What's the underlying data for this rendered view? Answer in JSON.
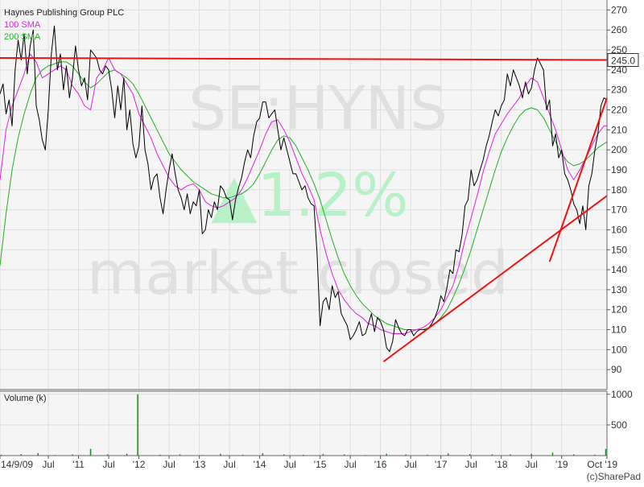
{
  "chart_data": {
    "type": "line",
    "title": "Haynes Publishing Group PLC",
    "watermark": {
      "ticker": "SE:HYNS",
      "change": "▲1.2%",
      "status": "market closed"
    },
    "last_price_label": "245.0",
    "credit": "(c)SharePad",
    "colors": {
      "price": "#000000",
      "sma100": "#e020e0",
      "sma200": "#20b020",
      "trend": "#ee1111",
      "volume": "#1a8a1a",
      "grid": "#dddddd",
      "bg": "#f5f5f5",
      "watermark": "#e0e0e0",
      "watermark_change": "#b8f0c8"
    },
    "legend": [
      "100 SMA",
      "200 SMA"
    ],
    "x_ticks": [
      "14/9/09",
      "Jul",
      "'11",
      "Jul",
      "'12",
      "Jul",
      "'13",
      "Jul",
      "'14",
      "Jul",
      "'15",
      "Jul",
      "'16",
      "Jul",
      "'17",
      "Jul",
      "'18",
      "Jul",
      "'19",
      "Oct '19"
    ],
    "x_tick_values": [
      2009.7,
      2010.5,
      2011.0,
      2011.5,
      2012.0,
      2012.5,
      2013.0,
      2013.5,
      2014.0,
      2014.5,
      2015.0,
      2015.5,
      2016.0,
      2016.5,
      2017.0,
      2017.5,
      2018.0,
      2018.5,
      2019.0,
      2019.75
    ],
    "xlim": [
      2009.7,
      2019.75
    ],
    "ylim": [
      80,
      275
    ],
    "y_ticks": [
      90,
      100,
      110,
      120,
      130,
      140,
      150,
      160,
      170,
      180,
      190,
      200,
      210,
      220,
      230,
      240,
      250,
      260,
      270
    ],
    "price": {
      "x": [
        2009.7,
        2009.75,
        2009.8,
        2009.85,
        2009.9,
        2009.95,
        2010.0,
        2010.05,
        2010.1,
        2010.15,
        2010.2,
        2010.25,
        2010.3,
        2010.35,
        2010.4,
        2010.45,
        2010.5,
        2010.55,
        2010.6,
        2010.65,
        2010.7,
        2010.75,
        2010.8,
        2010.85,
        2010.9,
        2010.95,
        2011.0,
        2011.05,
        2011.1,
        2011.15,
        2011.2,
        2011.25,
        2011.3,
        2011.35,
        2011.4,
        2011.45,
        2011.5,
        2011.55,
        2011.6,
        2011.65,
        2011.7,
        2011.75,
        2011.8,
        2011.85,
        2011.9,
        2011.95,
        2012.0,
        2012.05,
        2012.1,
        2012.15,
        2012.2,
        2012.25,
        2012.3,
        2012.35,
        2012.4,
        2012.45,
        2012.5,
        2012.55,
        2012.6,
        2012.65,
        2012.7,
        2012.75,
        2012.8,
        2012.85,
        2012.9,
        2012.95,
        2013.0,
        2013.05,
        2013.1,
        2013.15,
        2013.2,
        2013.25,
        2013.3,
        2013.35,
        2013.4,
        2013.45,
        2013.5,
        2013.55,
        2013.6,
        2013.65,
        2013.7,
        2013.75,
        2013.8,
        2013.85,
        2013.9,
        2013.95,
        2014.0,
        2014.05,
        2014.1,
        2014.15,
        2014.2,
        2014.25,
        2014.3,
        2014.35,
        2014.4,
        2014.45,
        2014.5,
        2014.55,
        2014.6,
        2014.65,
        2014.7,
        2014.75,
        2014.8,
        2014.85,
        2014.9,
        2014.95,
        2015.0,
        2015.05,
        2015.1,
        2015.15,
        2015.2,
        2015.25,
        2015.3,
        2015.35,
        2015.4,
        2015.45,
        2015.5,
        2015.55,
        2015.6,
        2015.65,
        2015.7,
        2015.75,
        2015.8,
        2015.85,
        2015.9,
        2015.95,
        2016.0,
        2016.05,
        2016.1,
        2016.15,
        2016.2,
        2016.25,
        2016.3,
        2016.35,
        2016.4,
        2016.45,
        2016.5,
        2016.55,
        2016.6,
        2016.65,
        2016.7,
        2016.75,
        2016.8,
        2016.85,
        2016.9,
        2016.95,
        2017.0,
        2017.05,
        2017.1,
        2017.15,
        2017.2,
        2017.25,
        2017.3,
        2017.35,
        2017.4,
        2017.45,
        2017.5,
        2017.55,
        2017.6,
        2017.65,
        2017.7,
        2017.75,
        2017.8,
        2017.85,
        2017.9,
        2017.95,
        2018.0,
        2018.05,
        2018.1,
        2018.15,
        2018.2,
        2018.25,
        2018.3,
        2018.35,
        2018.4,
        2018.45,
        2018.5,
        2018.55,
        2018.6,
        2018.65,
        2018.7,
        2018.75,
        2018.8,
        2018.85,
        2018.9,
        2018.95,
        2019.0,
        2019.05,
        2019.1,
        2019.15,
        2019.2,
        2019.25,
        2019.3,
        2019.35,
        2019.4,
        2019.45,
        2019.5,
        2019.55,
        2019.6,
        2019.65,
        2019.7,
        2019.75
      ],
      "y": [
        228,
        233,
        218,
        225,
        212,
        240,
        255,
        245,
        258,
        238,
        252,
        260,
        222,
        215,
        205,
        200,
        220,
        248,
        262,
        240,
        248,
        230,
        242,
        226,
        236,
        252,
        240,
        232,
        236,
        225,
        250,
        248,
        246,
        240,
        238,
        242,
        240,
        230,
        216,
        232,
        220,
        236,
        210,
        220,
        203,
        196,
        202,
        222,
        200,
        193,
        180,
        186,
        188,
        176,
        168,
        180,
        190,
        198,
        188,
        180,
        176,
        170,
        178,
        168,
        174,
        172,
        180,
        158,
        160,
        170,
        166,
        174,
        170,
        182,
        180,
        176,
        175,
        165,
        175,
        181,
        186,
        194,
        200,
        196,
        207,
        214,
        216,
        224,
        224,
        216,
        218,
        220,
        210,
        200,
        206,
        200,
        194,
        188,
        188,
        184,
        180,
        182,
        176,
        173,
        172,
        148,
        112,
        124,
        126,
        120,
        132,
        126,
        129,
        118,
        115,
        112,
        105,
        107,
        110,
        114,
        107,
        108,
        113,
        118,
        109,
        116,
        114,
        110,
        101,
        99,
        104,
        115,
        111,
        108,
        107,
        110,
        110,
        107,
        109,
        110,
        110,
        110,
        111,
        113,
        116,
        120,
        127,
        124,
        131,
        140,
        138,
        150,
        149,
        157,
        172,
        175,
        190,
        182,
        185,
        190,
        195,
        202,
        207,
        214,
        220,
        217,
        222,
        225,
        238,
        232,
        240,
        236,
        232,
        226,
        234,
        228,
        231,
        240,
        246,
        243,
        240,
        220,
        225,
        202,
        208,
        196,
        200,
        188,
        185,
        180,
        173,
        170,
        163,
        172,
        160,
        182,
        188,
        200,
        208,
        222,
        226,
        225,
        222,
        220,
        221,
        245
      ]
    },
    "sma100": {
      "x": [
        2009.7,
        2009.8,
        2009.9,
        2010.0,
        2010.1,
        2010.2,
        2010.3,
        2010.4,
        2010.5,
        2010.6,
        2010.7,
        2010.8,
        2010.9,
        2011.0,
        2011.1,
        2011.2,
        2011.3,
        2011.4,
        2011.5,
        2011.6,
        2011.7,
        2011.8,
        2011.9,
        2012.0,
        2012.1,
        2012.2,
        2012.3,
        2012.4,
        2012.5,
        2012.6,
        2012.7,
        2012.8,
        2012.9,
        2013.0,
        2013.1,
        2013.2,
        2013.3,
        2013.4,
        2013.5,
        2013.6,
        2013.7,
        2013.8,
        2013.9,
        2014.0,
        2014.1,
        2014.2,
        2014.3,
        2014.4,
        2014.5,
        2014.6,
        2014.7,
        2014.8,
        2014.9,
        2015.0,
        2015.1,
        2015.2,
        2015.3,
        2015.4,
        2015.5,
        2015.6,
        2015.7,
        2015.8,
        2015.9,
        2016.0,
        2016.1,
        2016.2,
        2016.3,
        2016.4,
        2016.5,
        2016.6,
        2016.7,
        2016.8,
        2016.9,
        2017.0,
        2017.1,
        2017.2,
        2017.3,
        2017.4,
        2017.5,
        2017.6,
        2017.7,
        2017.8,
        2017.9,
        2018.0,
        2018.1,
        2018.2,
        2018.3,
        2018.4,
        2018.5,
        2018.6,
        2018.7,
        2018.8,
        2018.9,
        2019.0,
        2019.1,
        2019.2,
        2019.3,
        2019.4,
        2019.5,
        2019.6,
        2019.7,
        2019.75
      ],
      "y": [
        185,
        210,
        222,
        230,
        238,
        248,
        244,
        236,
        238,
        240,
        242,
        240,
        232,
        228,
        222,
        220,
        236,
        240,
        246,
        240,
        238,
        233,
        228,
        218,
        212,
        206,
        198,
        192,
        186,
        182,
        180,
        182,
        183,
        180,
        174,
        172,
        171,
        172,
        174,
        176,
        180,
        186,
        193,
        200,
        208,
        214,
        215,
        210,
        204,
        196,
        188,
        182,
        175,
        160,
        148,
        138,
        130,
        125,
        121,
        118,
        116,
        113,
        112,
        110,
        109,
        108,
        108,
        108,
        109,
        110,
        111,
        113,
        116,
        120,
        126,
        132,
        142,
        155,
        166,
        177,
        189,
        199,
        208,
        213,
        218,
        222,
        226,
        232,
        236,
        234,
        226,
        218,
        210,
        200,
        190,
        185,
        190,
        196,
        202,
        208,
        212,
        212
      ]
    },
    "sma200": {
      "x": [
        2009.7,
        2009.8,
        2009.9,
        2010.0,
        2010.1,
        2010.2,
        2010.3,
        2010.4,
        2010.5,
        2010.6,
        2010.7,
        2010.8,
        2010.9,
        2011.0,
        2011.1,
        2011.2,
        2011.3,
        2011.4,
        2011.5,
        2011.6,
        2011.7,
        2011.8,
        2011.9,
        2012.0,
        2012.1,
        2012.2,
        2012.3,
        2012.4,
        2012.5,
        2012.6,
        2012.7,
        2012.8,
        2012.9,
        2013.0,
        2013.1,
        2013.2,
        2013.3,
        2013.4,
        2013.5,
        2013.6,
        2013.7,
        2013.8,
        2013.9,
        2014.0,
        2014.1,
        2014.2,
        2014.3,
        2014.4,
        2014.5,
        2014.6,
        2014.7,
        2014.8,
        2014.9,
        2015.0,
        2015.1,
        2015.2,
        2015.3,
        2015.4,
        2015.5,
        2015.6,
        2015.7,
        2015.8,
        2015.9,
        2016.0,
        2016.1,
        2016.2,
        2016.3,
        2016.4,
        2016.5,
        2016.6,
        2016.7,
        2016.8,
        2016.9,
        2017.0,
        2017.1,
        2017.2,
        2017.3,
        2017.4,
        2017.5,
        2017.6,
        2017.7,
        2017.8,
        2017.9,
        2018.0,
        2018.1,
        2018.2,
        2018.3,
        2018.4,
        2018.5,
        2018.6,
        2018.7,
        2018.8,
        2018.9,
        2019.0,
        2019.1,
        2019.2,
        2019.3,
        2019.4,
        2019.5,
        2019.6,
        2019.7,
        2019.75
      ],
      "y": [
        142,
        168,
        190,
        206,
        218,
        228,
        236,
        240,
        242,
        243,
        244,
        244,
        242,
        238,
        234,
        231,
        233,
        236,
        239,
        240,
        238,
        236,
        233,
        228,
        222,
        216,
        210,
        204,
        198,
        194,
        190,
        187,
        184,
        182,
        180,
        178,
        177,
        176,
        176,
        177,
        178,
        180,
        183,
        188,
        194,
        200,
        205,
        207,
        206,
        202,
        196,
        190,
        183,
        175,
        165,
        155,
        146,
        138,
        132,
        127,
        123,
        120,
        117,
        115,
        113,
        112,
        111,
        110,
        110,
        110,
        110,
        111,
        113,
        116,
        120,
        126,
        133,
        141,
        150,
        160,
        170,
        180,
        190,
        199,
        206,
        212,
        217,
        220,
        221,
        220,
        216,
        210,
        204,
        198,
        194,
        192,
        193,
        195,
        198,
        201,
        203,
        204
      ]
    },
    "trendlines": [
      {
        "x": [
          2009.7,
          2019.75
        ],
        "y": [
          246,
          245
        ]
      },
      {
        "x": [
          2016.05,
          2019.75
        ],
        "y": [
          94,
          177
        ]
      },
      {
        "x": [
          2018.8,
          2019.75
        ],
        "y": [
          144,
          226
        ]
      }
    ],
    "volume": {
      "ylabel": "Volume (k)",
      "ylim": [
        0,
        1050
      ],
      "y_ticks": [
        500,
        1000
      ],
      "x": [
        2009.72,
        2010.05,
        2010.33,
        2010.62,
        2010.9,
        2011.2,
        2011.48,
        2011.8,
        2011.98,
        2012.35,
        2012.68,
        2013.05,
        2013.35,
        2013.72,
        2014.05,
        2014.4,
        2014.72,
        2015.05,
        2015.4,
        2015.75,
        2016.1,
        2016.42,
        2016.78,
        2017.12,
        2017.48,
        2017.85,
        2018.15,
        2018.5,
        2018.85,
        2019.2,
        2019.55,
        2019.73
      ],
      "values": [
        15,
        25,
        40,
        10,
        20,
        110,
        20,
        30,
        1000,
        15,
        20,
        10,
        30,
        15,
        40,
        20,
        15,
        25,
        20,
        10,
        30,
        20,
        15,
        35,
        25,
        20,
        20,
        30,
        50,
        20,
        15,
        110
      ]
    }
  }
}
